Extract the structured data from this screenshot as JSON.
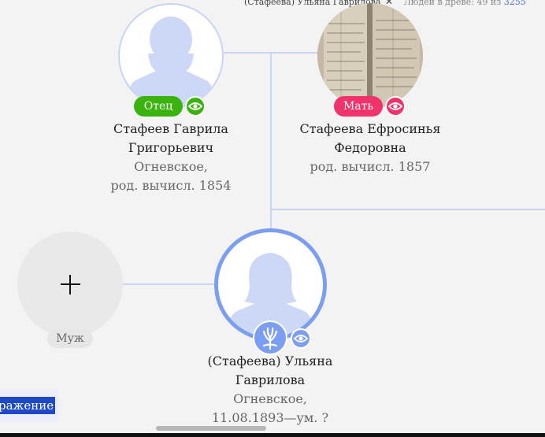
{
  "header": {
    "person": "(Стафеева) Ульяна Гаврилова",
    "close_glyph": "✕",
    "count_prefix": "Людей в древе: 49 из",
    "count_total": "3255"
  },
  "father": {
    "badge": "Отец",
    "name_line1": "Стафеев Гаврила",
    "name_line2": "Григорьевич",
    "place": "Огневское,",
    "dates": "род. вычисл. 1854"
  },
  "mother": {
    "badge": "Мать",
    "name_line1": "Стафеева Ефросинья",
    "name_line2": "Федоровна",
    "dates": "род. вычисл. 1857"
  },
  "spouse_slot": {
    "label": "Муж",
    "icon": "plus-icon"
  },
  "person": {
    "name_line1": "(Стафеева) Ульяна",
    "name_line2": "Гаврилова",
    "place": "Огневское,",
    "dates": "11.08.1893—ум. ?"
  },
  "display_button": {
    "label": "ражение"
  },
  "colors": {
    "father_badge": "#3bb30f",
    "mother_badge": "#f0336b",
    "accent_blue": "#7c9ef0",
    "connector": "#c9d4f3",
    "avatar_silhouette": "#cdd8f7",
    "button_blue": "#1f49c6"
  }
}
